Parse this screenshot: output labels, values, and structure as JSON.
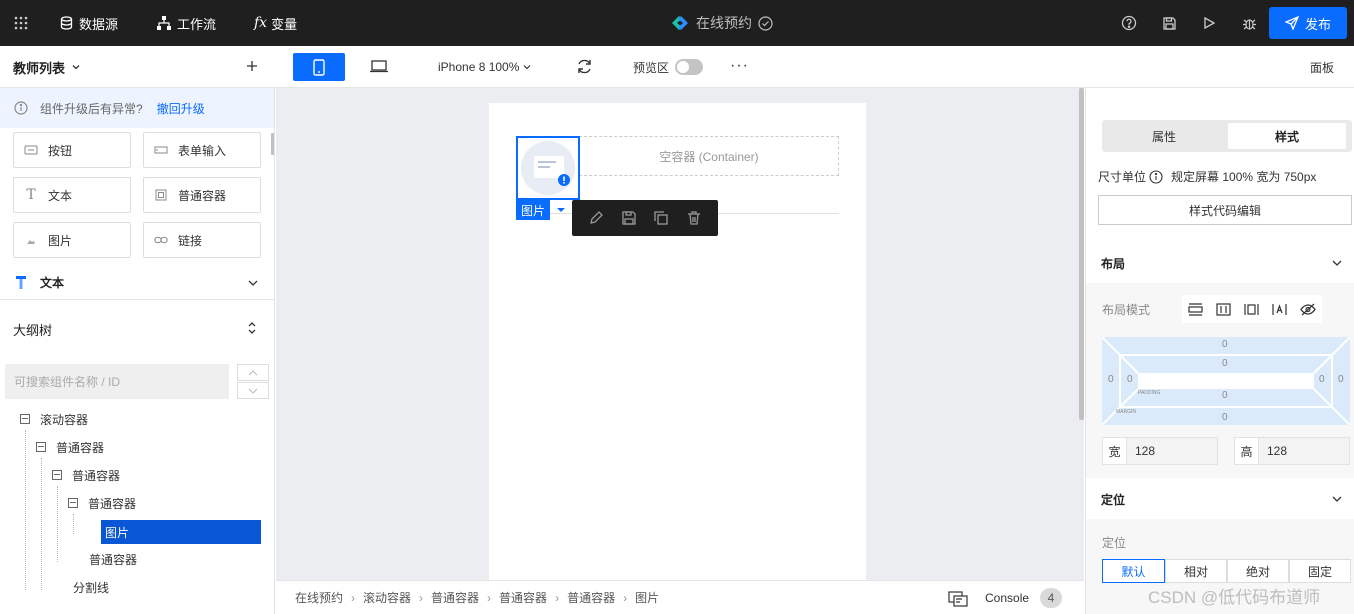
{
  "topbar": {
    "datasource": "数据源",
    "workflow": "工作流",
    "variable": "变量",
    "app_title": "在线预约",
    "publish": "发布"
  },
  "secbar": {
    "panel_title": "教师列表",
    "device": "iPhone 8 100%",
    "preview_label": "预览区",
    "panel_btn": "面板"
  },
  "left": {
    "notice_text": "组件升级后有异常?",
    "notice_link": "撤回升级",
    "components": [
      {
        "label": "按钮",
        "icon": "button-icon"
      },
      {
        "label": "表单输入",
        "icon": "input-icon"
      },
      {
        "label": "文本",
        "icon": "text-icon"
      },
      {
        "label": "普通容器",
        "icon": "container-icon"
      },
      {
        "label": "图片",
        "icon": "image-icon"
      },
      {
        "label": "链接",
        "icon": "link-icon"
      }
    ],
    "text_section": "文本",
    "outline_title": "大纲树",
    "search_placeholder": "可搜索组件名称 / ID",
    "tree": [
      {
        "label": "滚动容器"
      },
      {
        "label": "普通容器"
      },
      {
        "label": "普通容器"
      },
      {
        "label": "普通容器"
      },
      {
        "label": "图片"
      },
      {
        "label": "普通容器"
      },
      {
        "label": "分割线"
      }
    ]
  },
  "canvas": {
    "container_placeholder": "空容器 (Container)",
    "selected_tag": "图片"
  },
  "breadcrumb": [
    "在线预约",
    "滚动容器",
    "普通容器",
    "普通容器",
    "普通容器",
    "图片"
  ],
  "console": {
    "label": "Console",
    "count": "4"
  },
  "right": {
    "tab_props": "属性",
    "tab_style": "样式",
    "size_unit_label": "尺寸单位",
    "size_unit_value": "规定屏幕 100% 宽为 750px",
    "style_code_btn": "样式代码编辑",
    "layout_title": "布局",
    "layout_mode_label": "布局模式",
    "box": {
      "margin_top": "0",
      "padding_top": "0",
      "inner_top": "0",
      "left_outer": "0",
      "left_inner": "0",
      "right_inner": "0",
      "right_outer": "0",
      "inner_bottom": "0",
      "padding_bottom": "0",
      "margin_bottom": "0",
      "padding_label": "PADDING",
      "margin_label": "MARGIN"
    },
    "width_label": "宽",
    "width_value": "128",
    "height_label": "高",
    "height_value": "128",
    "position_title": "定位",
    "position_label": "定位",
    "position_options": [
      "默认",
      "相对",
      "绝对",
      "固定"
    ]
  },
  "watermark": "CSDN @低代码布道师"
}
